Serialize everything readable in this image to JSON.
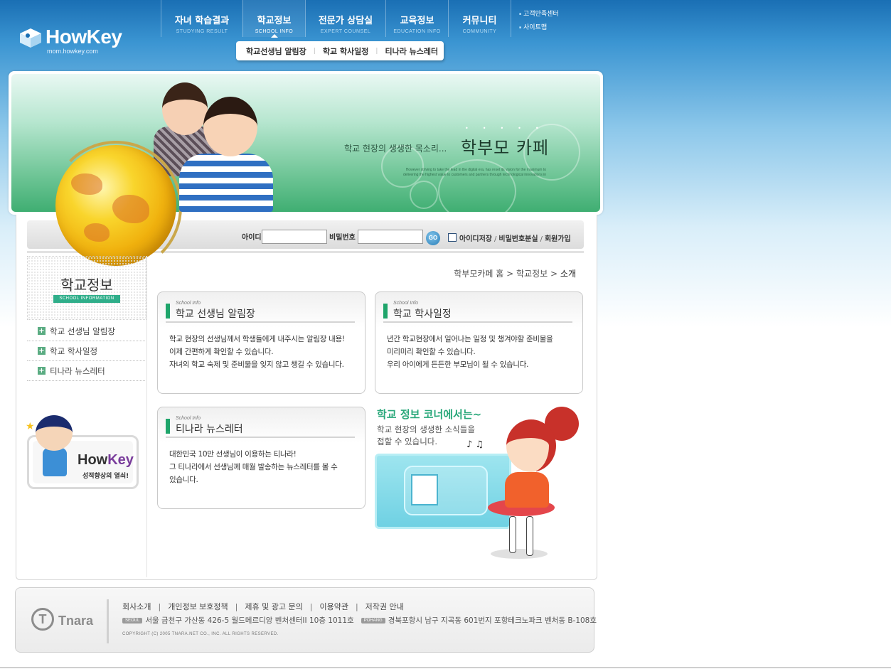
{
  "brand": {
    "logo_text": "HowKey",
    "logo_url": "mom.howkey.com"
  },
  "gnb": [
    {
      "label": "자녀 학습결과",
      "sub": "STUDYING RESULT",
      "active": false
    },
    {
      "label": "학교정보",
      "sub": "SCHOOL INFO",
      "active": true
    },
    {
      "label": "전문가 상담실",
      "sub": "EXPERT COUNSEL",
      "active": false
    },
    {
      "label": "교육정보",
      "sub": "EDUCATION INFO",
      "active": false
    },
    {
      "label": "커뮤니티",
      "sub": "COMMUNITY",
      "active": false
    }
  ],
  "util": {
    "customer_center": "고객만족센터",
    "sitemap": "사이트맵"
  },
  "submenu": [
    "학교선생님 알림장",
    "학교 학사일정",
    "티나라 뉴스레터"
  ],
  "banner": {
    "tagline": "학교 현장의 생생한 목소리...",
    "title": "학부모 카페",
    "small_text": "However striving to take the lead in the digital era, has reset its vision for the maximum to delivering the highest value to customers and partners through technological innovations in"
  },
  "login": {
    "id_label": "아이디",
    "id_value": "",
    "pw_label": "비밀번호",
    "pw_value": "",
    "go_label": "GO",
    "save_id": "아이디저장",
    "lost_pw": "비밀번호분실",
    "join": "회원가입"
  },
  "left": {
    "title": "학교정보",
    "title_en": "SCHOOL INFORMATION",
    "nav": [
      "학교 선생님 알림장",
      "학교 학사일정",
      "티나라 뉴스레터"
    ],
    "promo_brand_a": "How",
    "promo_brand_b": "Key",
    "promo_slogan": "성적향상의 열쇠!"
  },
  "breadcrumb": {
    "home": "학부모카페 홈",
    "section": "학교정보",
    "current": "소개",
    "sep": ">"
  },
  "boxes": [
    {
      "sub": "School Info",
      "title": "학교 선생님 알림장",
      "lines": [
        "학교 현장의 선생님께서 학생들에게 내주시는 알림장 내용!",
        "이제 간편하게 확인할 수 있습니다.",
        "자녀의 학교 숙제 및 준비물을 잊지 않고 챙길 수 있습니다."
      ]
    },
    {
      "sub": "School Info",
      "title": "학교 학사일정",
      "lines": [
        "년간 학교현장에서 일어나는 일정 및 챙겨야할 준비물을",
        "미리미리 확인할 수 있습니다.",
        "우리 아이에게 든든한 부모님이 될 수 있습니다."
      ]
    },
    {
      "sub": "School Info",
      "title": "티나라 뉴스레터",
      "lines": [
        "대한민국 10만 선생님이 이용하는 티나라!",
        "그 티나라에서 선생님께 매월 발송하는 뉴스레터를 볼 수",
        "있습니다."
      ]
    }
  ],
  "corner": {
    "title": "학교 정보 코너에서는~",
    "desc1": "학교 현장의 생생한 소식들을",
    "desc2": "접할 수 있습니다."
  },
  "footer": {
    "brand": "Tnara",
    "links": [
      "회사소개",
      "개인정보 보호정책",
      "제휴 및 광고 문의",
      "이용약관",
      "저작권 안내"
    ],
    "sep": "|",
    "seoul_badge": "SEOUL",
    "seoul_addr": "서울 금천구 가산동 426-5 월드메르디앙 벤처센터II 10층 1011호",
    "pohang_badge": "POHANG",
    "pohang_addr": "경북포항시 남구 지곡동 601번지 포항테크노파크 벤처동 B-108호",
    "copyright": "COPYRIGHT (C) 2005 TNARA.NET CO., INC. ALL RIGHTS RESERVED."
  },
  "colors": {
    "header_blue": "#1a6fb4",
    "green_accent": "#1fa56b",
    "corner_title": "#29a87a"
  }
}
